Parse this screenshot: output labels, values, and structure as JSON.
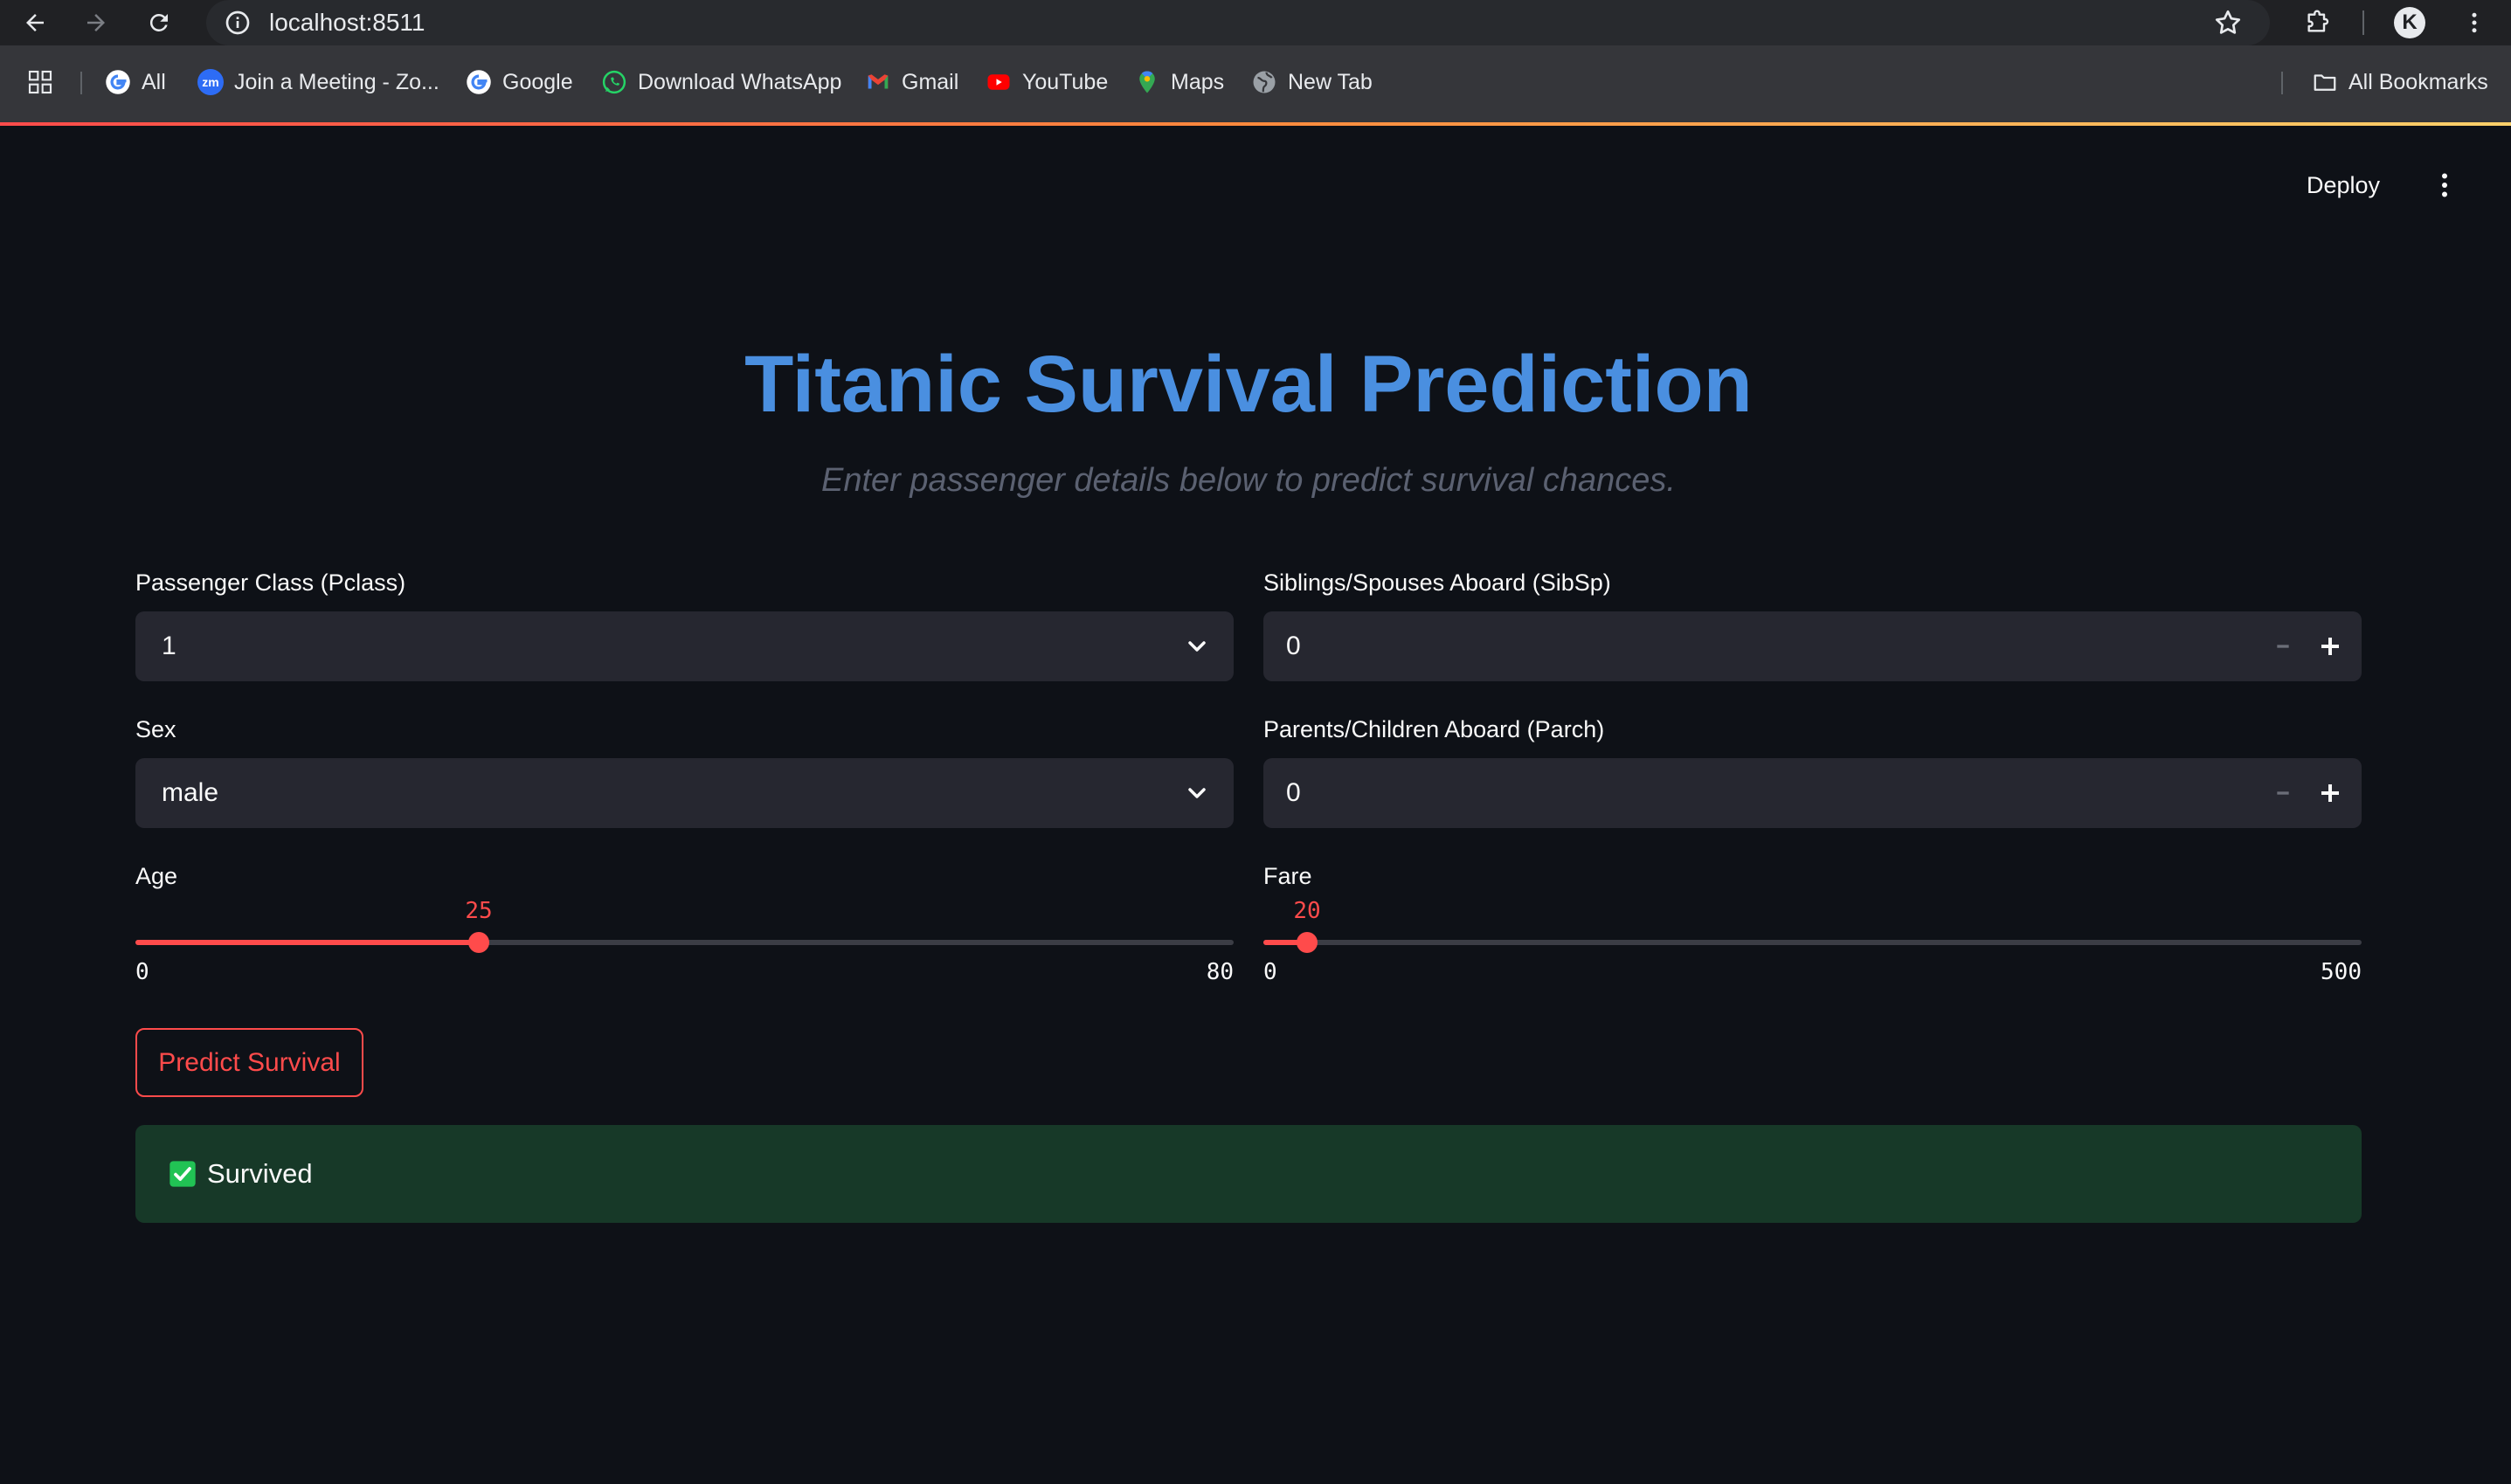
{
  "browser": {
    "url": "localhost:8511",
    "bookmarks": [
      {
        "label": "All",
        "icon": "google-icon"
      },
      {
        "label": "Join a Meeting - Zo...",
        "icon": "zoom-icon"
      },
      {
        "label": "Google",
        "icon": "google-icon"
      },
      {
        "label": "Download WhatsApp",
        "icon": "whatsapp-icon"
      },
      {
        "label": "Gmail",
        "icon": "gmail-icon"
      },
      {
        "label": "YouTube",
        "icon": "youtube-icon"
      },
      {
        "label": "Maps",
        "icon": "maps-icon"
      },
      {
        "label": "New Tab",
        "icon": "globe-icon"
      }
    ],
    "all_bookmarks": "All Bookmarks",
    "profile_initial": "K",
    "zoom_badge": "zm"
  },
  "app": {
    "deploy_label": "Deploy",
    "title": "Titanic Survival Prediction",
    "subtitle": "Enter passenger details below to predict survival chances.",
    "pclass": {
      "label": "Passenger Class (Pclass)",
      "value": "1"
    },
    "sex": {
      "label": "Sex",
      "value": "male"
    },
    "sibsp": {
      "label": "Siblings/Spouses Aboard (SibSp)",
      "value": "0"
    },
    "parch": {
      "label": "Parents/Children Aboard (Parch)",
      "value": "0"
    },
    "age": {
      "label": "Age",
      "value": 25,
      "min": 0,
      "max": 80
    },
    "fare": {
      "label": "Fare",
      "value": 20,
      "min": 0,
      "max": 500
    },
    "predict_button": "Predict Survival",
    "result": "Survived"
  },
  "colors": {
    "accent": "#ff4b4b",
    "title": "#4a8fe0",
    "background": "#0e1117",
    "input_bg": "#262730",
    "success_bg": "#173928",
    "success_icon": "#21c354"
  }
}
